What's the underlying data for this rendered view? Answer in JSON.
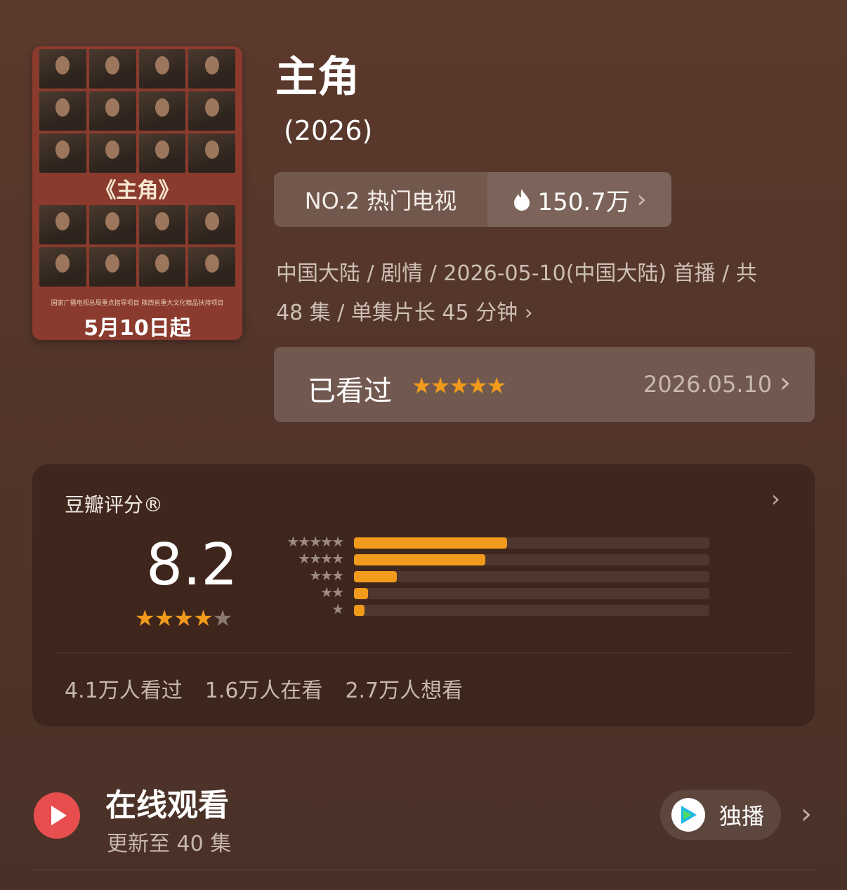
{
  "poster": {
    "title": "《主角》",
    "note": "国家广播电视总局重点指导项目  陕西省重大文化精品扶持项目",
    "date": "5月10日起"
  },
  "header": {
    "title": "主角",
    "year": "(2026)"
  },
  "rank": {
    "label": "NO.2 热门电视",
    "heat": "150.7万",
    "fire_icon": "fire-icon"
  },
  "meta": {
    "line1": "中国大陆 / 剧情 / 2026-05-10(中国大陆) 首播 / 共",
    "line2": "48 集 / 单集片长 45 分钟"
  },
  "watched": {
    "label": "已看过",
    "user_stars": 5,
    "date": "2026.05.10"
  },
  "rating": {
    "title": "豆瓣评分®",
    "score": "8.2",
    "score_stars": 4,
    "distribution": [
      {
        "stars": "★★★★★",
        "fraction": 0.43
      },
      {
        "stars": "★★★★",
        "fraction": 0.37
      },
      {
        "stars": "★★★",
        "fraction": 0.12
      },
      {
        "stars": "★★",
        "fraction": 0.04
      },
      {
        "stars": "★",
        "fraction": 0.03
      }
    ],
    "counts": {
      "watched": "4.1万人看过",
      "watching": "1.6万人在看",
      "wish": "2.7万人想看"
    }
  },
  "online": {
    "title": "在线观看",
    "subtitle": "更新至 40 集",
    "badge": "独播"
  },
  "colors": {
    "accent": "#f29a1b",
    "play": "#e84e4e"
  }
}
